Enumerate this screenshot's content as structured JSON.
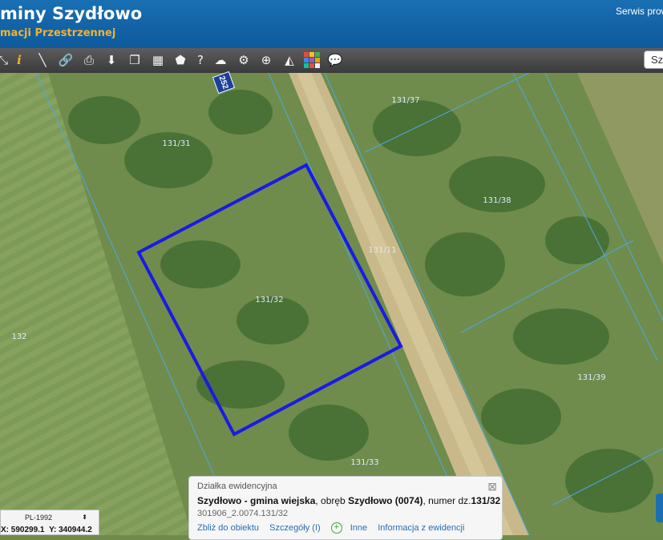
{
  "header": {
    "title": "miny Szydłowo",
    "subtitle": "macji Przestrzennej",
    "service_link": "Serwis prow"
  },
  "toolbar": {
    "tools": [
      "measure-distance-icon",
      "info-icon",
      "ruler-icon",
      "link-icon",
      "print-icon",
      "download-icon",
      "layers-icon",
      "layout-icon",
      "shape-icon",
      "help-icon",
      "upload-icon",
      "settings-icon",
      "zoom-search-icon",
      "sun-icon",
      "color-grid-icon",
      "comment-icon"
    ],
    "search_value": "Sz"
  },
  "map": {
    "parcel_labels": [
      "131/31",
      "131/37",
      "131/38",
      "131/11",
      "131/32",
      "132",
      "131/39",
      "131/33"
    ],
    "road_badge": "252",
    "selection_color": "#1a1ae6",
    "parcel_line_color": "#4aa8e8"
  },
  "popup": {
    "heading": "Działka ewidencyjna",
    "place": "Szydłowo - gmina wiejska",
    "precinct_prefix": ", obręb ",
    "precinct": "Szydłowo (0074)",
    "number_prefix": ", numer dz.",
    "number": "131/32",
    "id": "301906_2.0074.131/32",
    "links": {
      "zoom": "Zbliż do obiektu",
      "details": "Szczegóły (I)",
      "other": "Inne",
      "info": "Informacja z ewidencji"
    }
  },
  "coords": {
    "crs": "PL-1992",
    "x_label": "X:",
    "x_value": "590299.1",
    "y_label": "Y:",
    "y_value": "340944.2"
  }
}
